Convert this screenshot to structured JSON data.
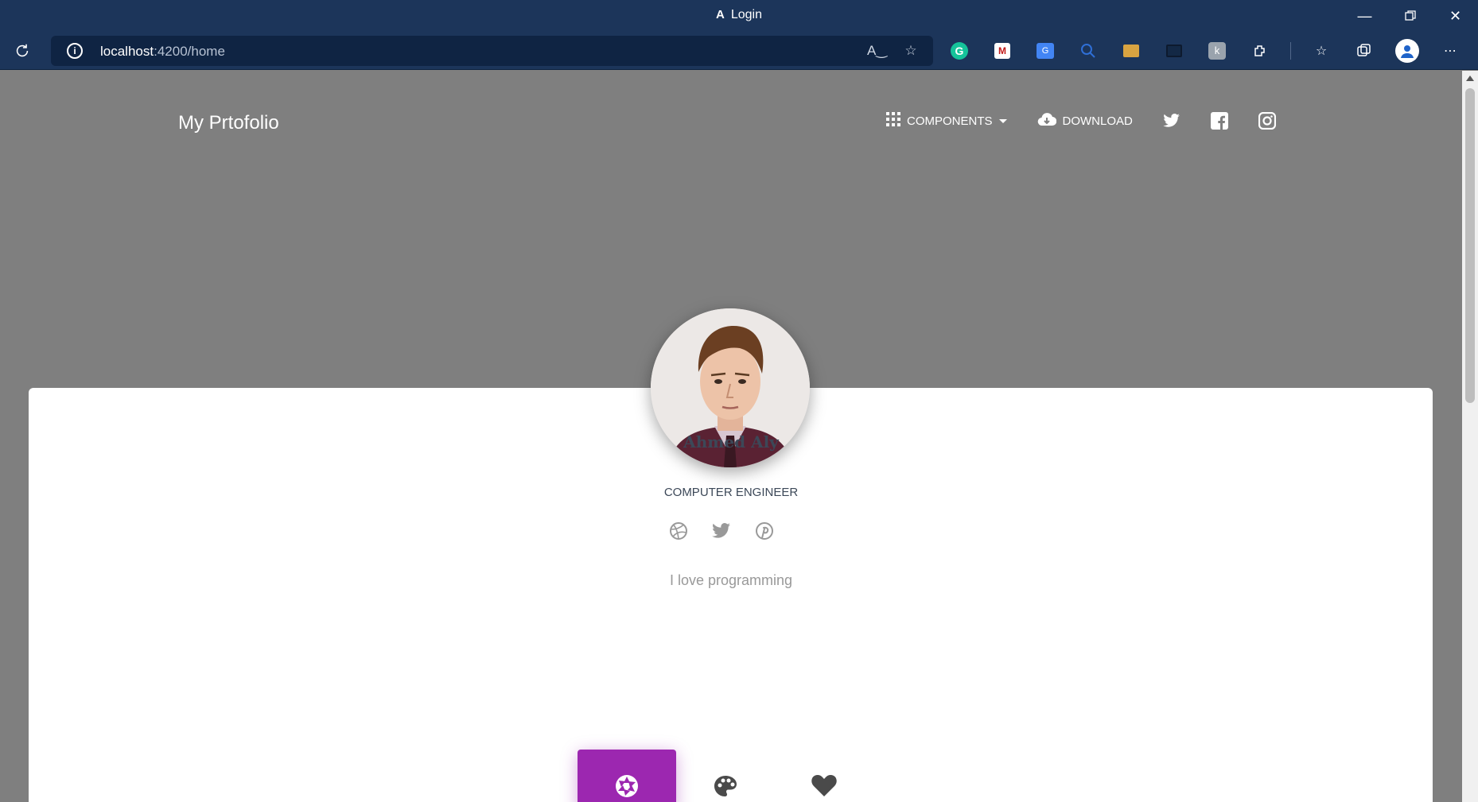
{
  "browser": {
    "tab_title": "Login",
    "app_logo": "A",
    "url_host": "localhost",
    "url_rest": ":4200/home",
    "icons": [
      "reload-icon",
      "info-icon",
      "read-aloud-icon",
      "add-favorite-icon"
    ],
    "extensions": [
      "grammarly-icon",
      "mcafee-icon",
      "google-translate-icon",
      "search-ext-icon",
      "folder-ext-icon",
      "pip-icon",
      "ext-k-icon",
      "extensions-icon",
      "favorites-icon",
      "collections-icon",
      "profile-icon",
      "more-icon"
    ]
  },
  "site": {
    "brand": "My Prtofolio",
    "nav": {
      "components_label": "COMPONENTS",
      "download_label": "DOWNLOAD"
    }
  },
  "profile": {
    "name": "Ahmed Aly",
    "role": "COMPUTER ENGINEER",
    "bio": "I love programming",
    "socials": [
      "dribbble-icon",
      "twitter-icon",
      "pinterest-icon"
    ]
  },
  "tabs": {
    "items": [
      "camera-icon",
      "palette-icon",
      "heart-icon"
    ],
    "active_color": "#9c27b0"
  },
  "colors": {
    "chrome": "#1c355a",
    "page_bg": "#7f7f7f",
    "accent": "#9c27b0"
  }
}
